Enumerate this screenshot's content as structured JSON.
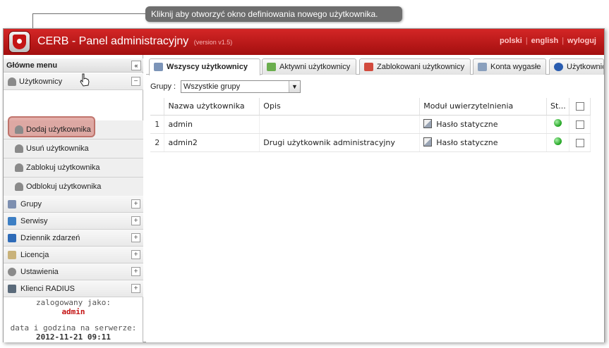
{
  "callout": {
    "text": "Kliknij aby otworzyć okno definiowania nowego użytkownika."
  },
  "header": {
    "title": "CERB - Panel administracyjny",
    "version": "(version v1.5)",
    "links": [
      "polski",
      "english",
      "wyloguj"
    ],
    "separator": "|"
  },
  "sidebar": {
    "title": "Główne menu",
    "collapse_symbol": "«",
    "users_section": {
      "label": "Użytkownicy",
      "toggle": "−"
    },
    "user_actions": [
      {
        "label": "Dodaj użytkownika"
      },
      {
        "label": "Usuń użytkownika"
      },
      {
        "label": "Zablokuj użytkownika"
      },
      {
        "label": "Odblokuj użytkownika"
      }
    ],
    "sections": [
      {
        "label": "Grupy",
        "toggle": "+"
      },
      {
        "label": "Serwisy",
        "toggle": "+"
      },
      {
        "label": "Dziennik zdarzeń",
        "toggle": "+"
      },
      {
        "label": "Licencja",
        "toggle": "+"
      },
      {
        "label": "Ustawienia",
        "toggle": "+"
      },
      {
        "label": "Klienci RADIUS",
        "toggle": "+"
      }
    ],
    "login": {
      "label": "zalogowany jako:",
      "user": "admin",
      "date_label": "data i godzina na serwerze:",
      "datetime": "2012-11-21 09:11"
    }
  },
  "tabs": [
    {
      "label": "Wszyscy użytkownicy",
      "active": true
    },
    {
      "label": "Aktywni użytkownicy",
      "active": false
    },
    {
      "label": "Zablokowani użytkownicy",
      "active": false
    },
    {
      "label": "Konta wygasłe",
      "active": false
    },
    {
      "label": "Użytkownic",
      "active": false
    }
  ],
  "filter": {
    "label": "Grupy :",
    "selected": "Wszystkie grupy",
    "arrow": "▼"
  },
  "table": {
    "columns": [
      "",
      "Nazwa użytkownika",
      "Opis",
      "Moduł uwierzytelnienia",
      "St...",
      ""
    ],
    "rows": [
      {
        "num": "1",
        "name": "admin",
        "desc": "",
        "auth": "Hasło statyczne"
      },
      {
        "num": "2",
        "name": "admin2",
        "desc": "Drugi użytkownik administracyjny",
        "auth": "Hasło statyczne"
      }
    ]
  },
  "colors": {
    "brand_red": "#c41414",
    "status_active": "#1fa21f"
  }
}
